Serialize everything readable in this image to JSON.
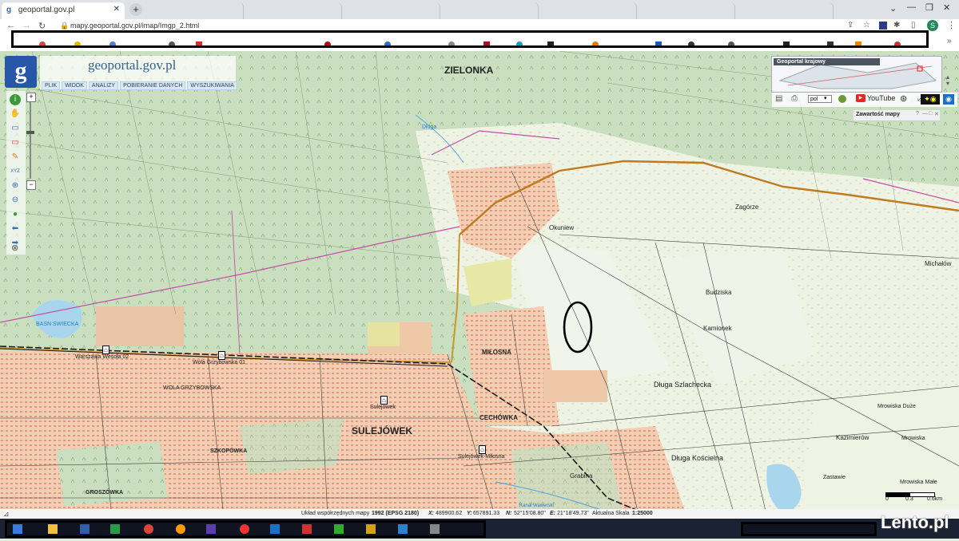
{
  "browser": {
    "active_tab_title": "geoportal.gov.pl",
    "url": "mapy.geoportal.gov.pl/imap/Imgp_2.html",
    "new_tab_label": "+",
    "profile_initial": "S"
  },
  "geoportal": {
    "logo_text": "geoportal.gov.pl",
    "menu": [
      "PLIK",
      "WIDOK",
      "ANALIZY",
      "POBIERANIE DANYCH",
      "WYSZUKIWANIA"
    ],
    "overview_title": "Geoportal krajowy",
    "language_select": "pol",
    "youtube_label": "YouTube",
    "panel_title": "Zawartość mapy"
  },
  "map_labels": {
    "zielonka": "ZIELONKA",
    "dluga": "Długa",
    "okuniew": "Okuniew",
    "zagorze": "Zagórze",
    "michalow": "Michałów",
    "budziska": "Budziska",
    "kamionek": "Kamionek",
    "milosna": "MIŁOSNA",
    "basn_swiecka": "BASN SWIECKA",
    "warszawa_wesola": "Warszawa Wesoła 02",
    "wola_grzybowska_01": "Wola Grzybowska 01",
    "wola_grzybowska": "WOLA GRZYBOWSKA",
    "sulejowek_station": "Sulejówek",
    "cechowka": "CECHÓWKA",
    "sulejowek": "SULEJÓWEK",
    "sulejowek_milosna": "Sulejówek-Miłosna",
    "szkopowka": "SZKOPÓWKA",
    "groszowka": "GROSZÓWKA",
    "grabina": "Grabina",
    "dluga_szlachecka": "Długa Szlachecka",
    "mrowiska_duze": "Mrowiska Duże",
    "kazimierow": "Kazimierów",
    "mrowiska": "Mrowiska",
    "dluga_koscielna": "Długa Kościelna",
    "zastawie": "Zastawie",
    "mrowiska_male": "Mrowiska Małe",
    "kanal": "Kanał Wawerski"
  },
  "scale_bar": {
    "tick0": "0",
    "tick1": "0.3",
    "tick2": "0.6km"
  },
  "status": {
    "crs_label": "Układ współrzędnych mapy",
    "crs_value": "1992 (EPSG 2180)",
    "x_label": "X:",
    "x_value": "489900.62",
    "y_label": "Y:",
    "y_value": "657891.33",
    "n_label": "N:",
    "n_value": "52°15'08.80\"",
    "e_label": "E:",
    "e_value": "21°18'49.73\"",
    "scale_label": "Aktualna Skala",
    "scale_value": "1:25000"
  },
  "watermark": "Lento.pl"
}
